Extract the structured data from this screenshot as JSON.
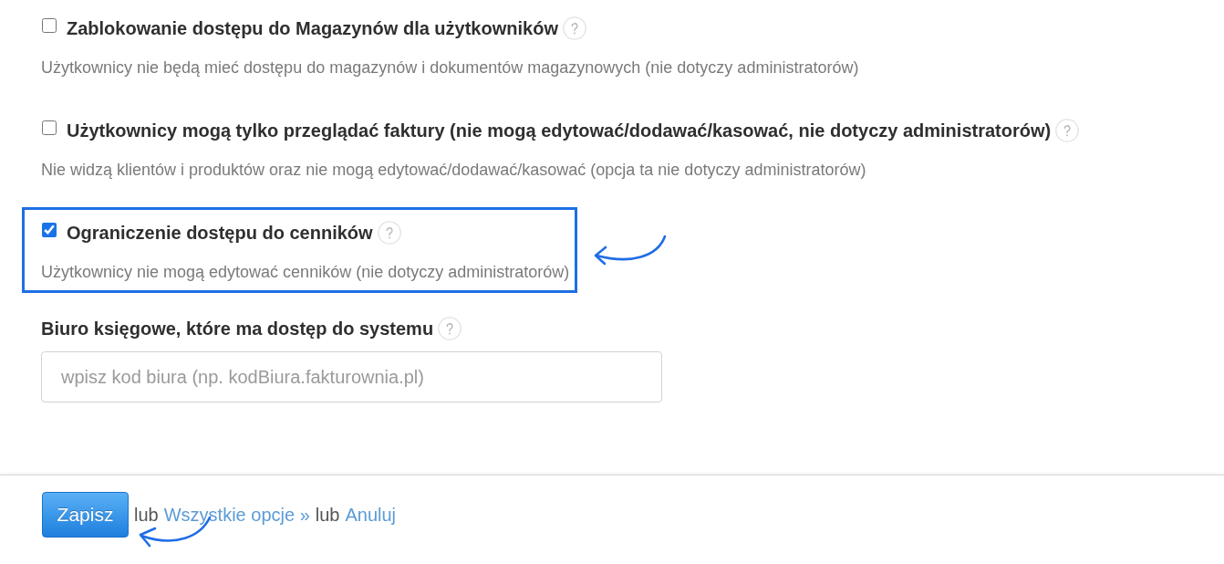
{
  "options": [
    {
      "label": "Zablokowanie dostępu do Magazynów dla użytkowników",
      "checked": false,
      "highlighted": false,
      "description": "Użytkownicy nie będą mieć dostępu do magazynów i dokumentów magazynowych (nie dotyczy administratorów)"
    },
    {
      "label": "Użytkownicy mogą tylko przeglądać faktury (nie mogą edytować/dodawać/kasować, nie dotyczy administratorów)",
      "checked": false,
      "highlighted": false,
      "description": "Nie widzą klientów i produktów oraz nie mogą edytować/dodawać/kasować (opcja ta nie dotyczy administratorów)"
    },
    {
      "label": "Ograniczenie dostępu do cenników",
      "checked": true,
      "highlighted": true,
      "description": "Użytkownicy nie mogą edytować cenników (nie dotyczy administratorów)"
    }
  ],
  "accounting_office": {
    "label": "Biuro księgowe, które ma dostęp do systemu",
    "placeholder": "wpisz kod biura (np. kodBiura.fakturownia.pl)"
  },
  "footer": {
    "save_button": "Zapisz",
    "separator_1": "lub",
    "all_options_link": "Wszystkie opcje »",
    "separator_2": "lub",
    "cancel_link": "Anuluj"
  }
}
